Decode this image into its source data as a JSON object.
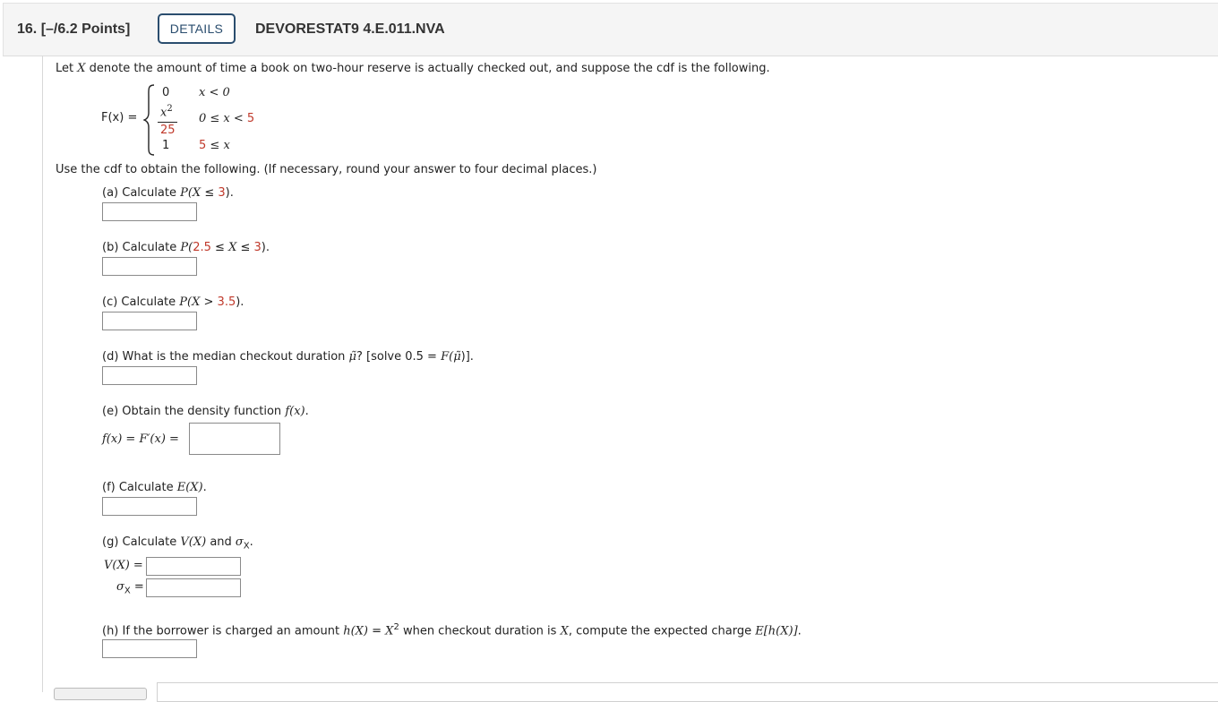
{
  "header": {
    "question_number": "16.",
    "points": "[–/6.2 Points]",
    "details_label": "DETAILS",
    "question_code": "DEVORESTAT9 4.E.011.NVA"
  },
  "intro": {
    "pre": "Let ",
    "var": "X",
    "post": " denote the amount of time a book on two-hour reserve is actually checked out, and suppose the cdf is the following."
  },
  "cdf": {
    "lhs": "F(x) =",
    "row1_value": "0",
    "row1_cond": "x < 0",
    "row2_num": "x",
    "row2_exp": "2",
    "row2_den": "25",
    "row2_cond_a": "0 ≤ x < ",
    "row2_cond_b": "5",
    "row3_value": "1",
    "row3_cond_a": "5",
    "row3_cond_b": " ≤ x"
  },
  "instructions": "Use the cdf to obtain the following. (If necessary, round your answer to four decimal places.)",
  "parts": {
    "a": {
      "pre": "(a) Calculate ",
      "p": "P(",
      "x": "X",
      "rel": " ≤ ",
      "val": "3",
      "end": ")."
    },
    "b": {
      "pre": "(b) Calculate ",
      "p": "P(",
      "v1": "2.5",
      "mid1": " ≤ ",
      "x": "X",
      "mid2": " ≤ ",
      "v2": "3",
      "end": ")."
    },
    "c": {
      "pre": "(c) Calculate ",
      "p": "P(",
      "x": "X",
      "rel": " > ",
      "val": "3.5",
      "end": ")."
    },
    "d": {
      "pre": "(d) What is the median checkout duration ",
      "mu": "μ̃",
      "mid": "? [solve 0.5 = ",
      "f": "F(",
      "mu2": "μ̃",
      "end": ")]."
    },
    "e": {
      "pre": "(e) Obtain the density function ",
      "f": "f(x)",
      "end": ".",
      "lhs": "f(x) = F′(x) ="
    },
    "f": {
      "pre": "(f) Calculate ",
      "e": "E(X)",
      "end": "."
    },
    "g": {
      "pre": "(g) Calculate ",
      "v": "V(X)",
      "and": " and ",
      "sigma": "σ",
      "sub": "X",
      "end": ".",
      "v_label": "V(X) =",
      "sigma_label": "σ",
      "sigma_sub": "X",
      "sigma_eq": " ="
    },
    "h": {
      "pre": "(h) If the borrower is charged an amount ",
      "hx": "h(X)",
      "eq": " = ",
      "x": "X",
      "exp": "2",
      "mid": " when checkout duration is ",
      "x2": "X",
      "mid2": ", compute the expected charge ",
      "ehx": "E[h(X)]",
      "end": "."
    }
  }
}
